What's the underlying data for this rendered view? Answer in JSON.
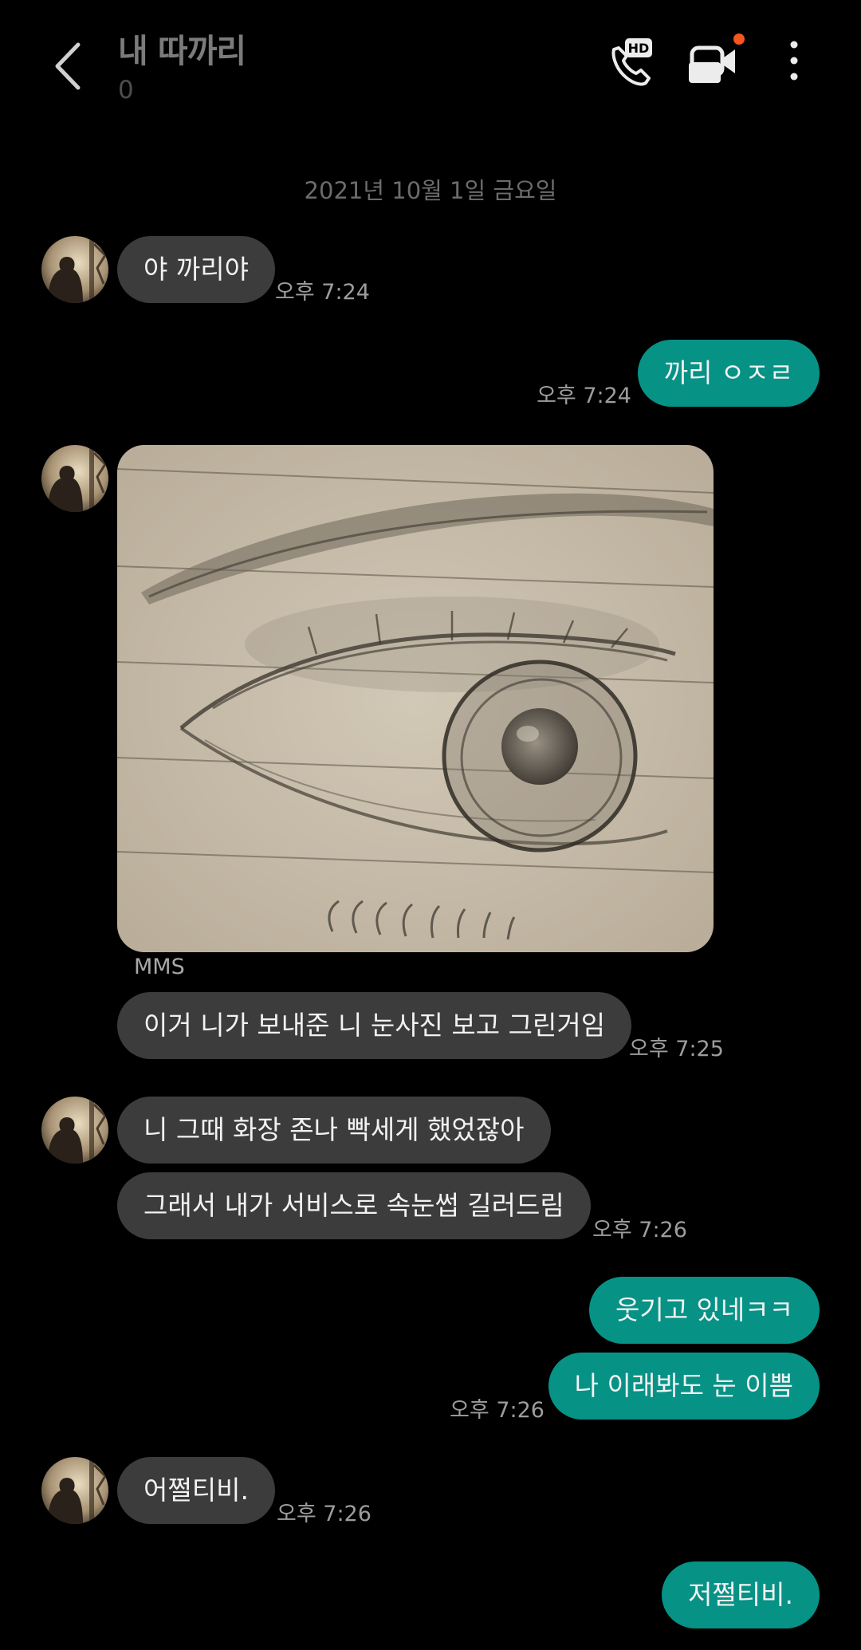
{
  "header": {
    "title": "내 따까리",
    "subtitle": "0",
    "icons": [
      "back-arrow-icon",
      "hd-voice-call-icon",
      "video-call-icon",
      "more-options-icon"
    ],
    "notification_dot_color": "#f5561e"
  },
  "date_divider": "2021년 10월 1일 금요일",
  "colors": {
    "incoming_bubble": "#3c3c3c",
    "outgoing_bubble": "#079286",
    "background": "#000000"
  },
  "messages": [
    {
      "dir": "in",
      "text": "야 까리야",
      "time": "오후 7:24"
    },
    {
      "dir": "out",
      "text": "까리 ㅇㅈㄹ",
      "time": "오후 7:24"
    },
    {
      "dir": "in",
      "type": "image",
      "label": "MMS"
    },
    {
      "dir": "in",
      "text": "이거 니가 보내준 니 눈사진 보고 그린거임",
      "time": "오후 7:25"
    },
    {
      "dir": "in",
      "text": "니 그때 화장 존나 빡세게 했었잖아"
    },
    {
      "dir": "in",
      "text": "그래서 내가 서비스로 속눈썹 길러드림",
      "time": "오후 7:26"
    },
    {
      "dir": "out",
      "text": "웃기고 있네ㅋㅋ"
    },
    {
      "dir": "out",
      "text": "나 이래봐도 눈 이쁨",
      "time": "오후 7:26"
    },
    {
      "dir": "in",
      "text": "어쩔티비.",
      "time": "오후 7:26"
    },
    {
      "dir": "out",
      "text": "저쩔티비."
    }
  ]
}
